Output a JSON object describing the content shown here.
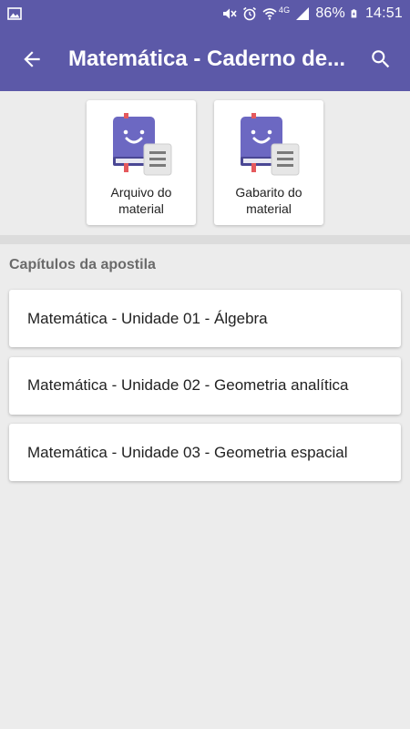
{
  "status_bar": {
    "battery_text": "86%",
    "time": "14:51",
    "network": "4G"
  },
  "appbar": {
    "title": "Matemática - Caderno de...",
    "back_icon": "arrow-back-icon",
    "search_icon": "search-icon"
  },
  "materials": [
    {
      "label": "Arquivo do material",
      "icon": "book-document-icon"
    },
    {
      "label": "Gabarito do material",
      "icon": "book-document-icon"
    }
  ],
  "section": {
    "title": "Capítulos da apostila"
  },
  "chapters": [
    {
      "label": "Matemática - Unidade 01 - Álgebra"
    },
    {
      "label": "Matemática - Unidade 02 - Geometria analítica"
    },
    {
      "label": "Matemática - Unidade 03 - Geometria espacial"
    }
  ],
  "colors": {
    "primary": "#5c59a8",
    "background": "#ececec",
    "book": "#6c68c2",
    "bookmark": "#e5595d"
  }
}
